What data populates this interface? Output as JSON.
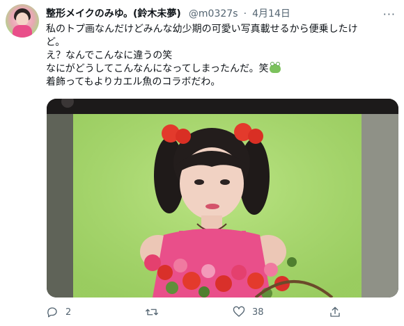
{
  "tweet": {
    "author": {
      "display_name": "整形メイクのみゆ。(鈴木未夢)",
      "handle": "@m0327s",
      "separator": "·",
      "date": "4月14日"
    },
    "text_lines": [
      "私のトプ画なんだけどみんな幼少期の可愛い写真載せるから便乗したけ",
      "ど。",
      "え？なんでこんなに違うの笑",
      "なにがどうしてこんなんになってしまったんだ。笑",
      "着飾ってもよりカエル魚のコラボだわ。"
    ],
    "line4_emoji": "frog-emoji",
    "actions": {
      "reply_count": "2",
      "retweet_count": "",
      "like_count": "38"
    }
  },
  "icons": {
    "more": "more-horizontal-icon",
    "reply": "reply-icon",
    "retweet": "retweet-icon",
    "like": "heart-icon",
    "share": "share-icon"
  },
  "colors": {
    "text_primary": "#0f1419",
    "text_secondary": "#536471",
    "photo_backdrop": "#a9d86f",
    "dress": "#e94f8a"
  }
}
